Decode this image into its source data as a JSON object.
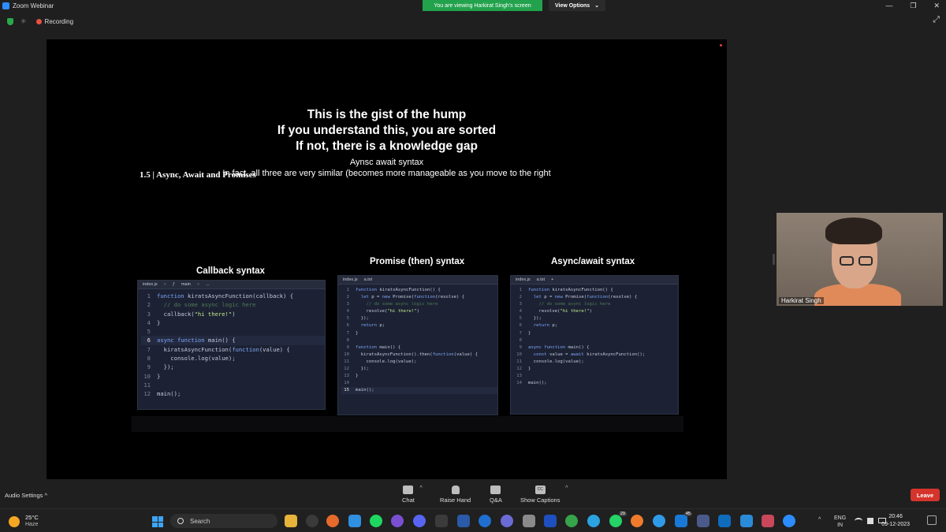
{
  "window": {
    "title": "Zoom Webinar",
    "viewing_banner": "You are viewing Harkirat Singh's screen",
    "view_options": "View Options",
    "view_options_caret": "⌄",
    "controls": [
      "—",
      "❐",
      "✕"
    ]
  },
  "status": {
    "recording_label": "Recording",
    "spark_glyph": "✳",
    "expand_glyph": "⤢"
  },
  "slide": {
    "gist_lines": [
      "This is the gist of the hump",
      "If you understand this, you are sorted",
      "If not, there is a knowledge gap"
    ],
    "section_title": "1.5 | Async, Await and Promises",
    "sub_line1": "Aynsc await syntax",
    "sub_line2": "In fact, all three are very similar (becomes more manageable as you move to the right",
    "columns": [
      {
        "title": "Callback syntax",
        "tabs": [
          "index.js",
          ">",
          "ƒ",
          "main",
          ">",
          "..."
        ],
        "lines": [
          {
            "n": "1",
            "code": "function kiratsAsyncFunction(callback) {"
          },
          {
            "n": "2",
            "code": "  // do some async logic here"
          },
          {
            "n": "3",
            "code": "  callback(\"hi there!\")"
          },
          {
            "n": "4",
            "code": "}"
          },
          {
            "n": "5",
            "code": ""
          },
          {
            "n": "6",
            "code": "async function main() {"
          },
          {
            "n": "7",
            "code": "  kiratsAsyncFunction(function(value) {"
          },
          {
            "n": "8",
            "code": "    console.log(value);"
          },
          {
            "n": "9",
            "code": "  });"
          },
          {
            "n": "10",
            "code": "}"
          },
          {
            "n": "11",
            "code": ""
          },
          {
            "n": "12",
            "code": "main();"
          }
        ]
      },
      {
        "title": "Promise (then) syntax",
        "tabs": [
          "index.js",
          "a.txt"
        ],
        "lines": [
          {
            "n": "1",
            "code": "function kiratsAsyncFunction() {"
          },
          {
            "n": "2",
            "code": "  let p = new Promise(function(resolve) {"
          },
          {
            "n": "3",
            "code": "    // do some async logic here"
          },
          {
            "n": "4",
            "code": "    resolve(\"hi there!\")"
          },
          {
            "n": "5",
            "code": "  });"
          },
          {
            "n": "6",
            "code": "  return p;"
          },
          {
            "n": "7",
            "code": "}"
          },
          {
            "n": "8",
            "code": ""
          },
          {
            "n": "9",
            "code": "function main() {"
          },
          {
            "n": "10",
            "code": "  kiratsAsyncFunction().then(function(value) {"
          },
          {
            "n": "11",
            "code": "    console.log(value);"
          },
          {
            "n": "12",
            "code": "  });"
          },
          {
            "n": "13",
            "code": "}"
          },
          {
            "n": "14",
            "code": ""
          },
          {
            "n": "15",
            "code": "main();"
          }
        ]
      },
      {
        "title": "Async/await syntax",
        "tabs": [
          "index.js",
          "a.txt",
          "+"
        ],
        "lines": [
          {
            "n": "1",
            "code": "function kiratsAsyncFunction() {"
          },
          {
            "n": "2",
            "code": "  let p = new Promise(function(resolve) {"
          },
          {
            "n": "3",
            "code": "    // do some async logic here"
          },
          {
            "n": "4",
            "code": "    resolve(\"hi there!\")"
          },
          {
            "n": "5",
            "code": "  });"
          },
          {
            "n": "6",
            "code": "  return p;"
          },
          {
            "n": "7",
            "code": "}"
          },
          {
            "n": "8",
            "code": ""
          },
          {
            "n": "9",
            "code": "async function main() {"
          },
          {
            "n": "10",
            "code": "  const value = await kiratsAsyncFunction();"
          },
          {
            "n": "11",
            "code": "  console.log(value);"
          },
          {
            "n": "12",
            "code": "}"
          },
          {
            "n": "13",
            "code": ""
          },
          {
            "n": "14",
            "code": "main();"
          }
        ]
      }
    ]
  },
  "participant": {
    "name": "Harkirat Singh"
  },
  "meeting_toolbar": {
    "audio_settings": "Audio Settings",
    "audio_caret": "^",
    "chat": "Chat",
    "raise_hand": "Raise Hand",
    "qa": "Q&A",
    "show_captions": "Show Captions",
    "leave": "Leave",
    "cc_glyph": "CC"
  },
  "taskbar": {
    "weather_temp": "25°C",
    "weather_desc": "Haze",
    "search_placeholder": "Search",
    "badge_whatsapp": "29",
    "badge_teams": "45",
    "lang_top": "ENG",
    "lang_bottom": "IN",
    "time": "20:46",
    "date": "09-12-2023",
    "tray_caret": "^"
  },
  "colors": {
    "zoom_blue": "#2d8cff",
    "banner_green": "#23a24d",
    "leave_red": "#d4342b",
    "recording_red": "#e8503f"
  }
}
